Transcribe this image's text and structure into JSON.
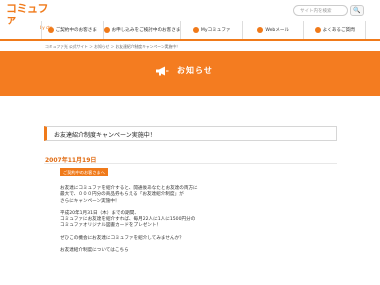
{
  "header": {
    "logo_main": "コミュファ",
    "logo_sub": "by ctc",
    "search_placeholder": "サイト内を検索",
    "search_button": "🔍"
  },
  "nav": {
    "items": [
      {
        "label": "ご契約中のお客さま"
      },
      {
        "label": "お申し込みをご検討中のお客さま"
      },
      {
        "label": "Myコミュファ"
      },
      {
        "label": "Webメール"
      },
      {
        "label": "よくあるご質問"
      }
    ]
  },
  "breadcrumb": "コミュファ光 公式サイト ＞ お知らせ ＞ お友達紹介制度キャンペーン実施中！",
  "banner": {
    "title": "お知らせ"
  },
  "article": {
    "title": "お友達紹介制度キャンペーン実施中！",
    "date": "2007年11月19日",
    "recipient": "ご契約中のお客さまへ",
    "paragraphs": [
      "お友達にコミュファを紹介すると、開通後あなたとお友達の両方に",
      "最大で、０００円分の商品券もらえる「お友達紹介制度」が",
      "さらにキャンペーン実施中！",
      "平成20年1月31日（木）までの期間、",
      "コミュファにお友達を紹介すれば、毎月22人に1人に1500円分の",
      "コミュファオリジナル図書カードをプレゼント！",
      "ぜひこの機会にお友達にコミュファを紹介してみませんか？",
      "お友達紹介制度についてはこちら"
    ]
  },
  "colors": {
    "brand": "#f07a1a",
    "banner": "#f47c20"
  }
}
